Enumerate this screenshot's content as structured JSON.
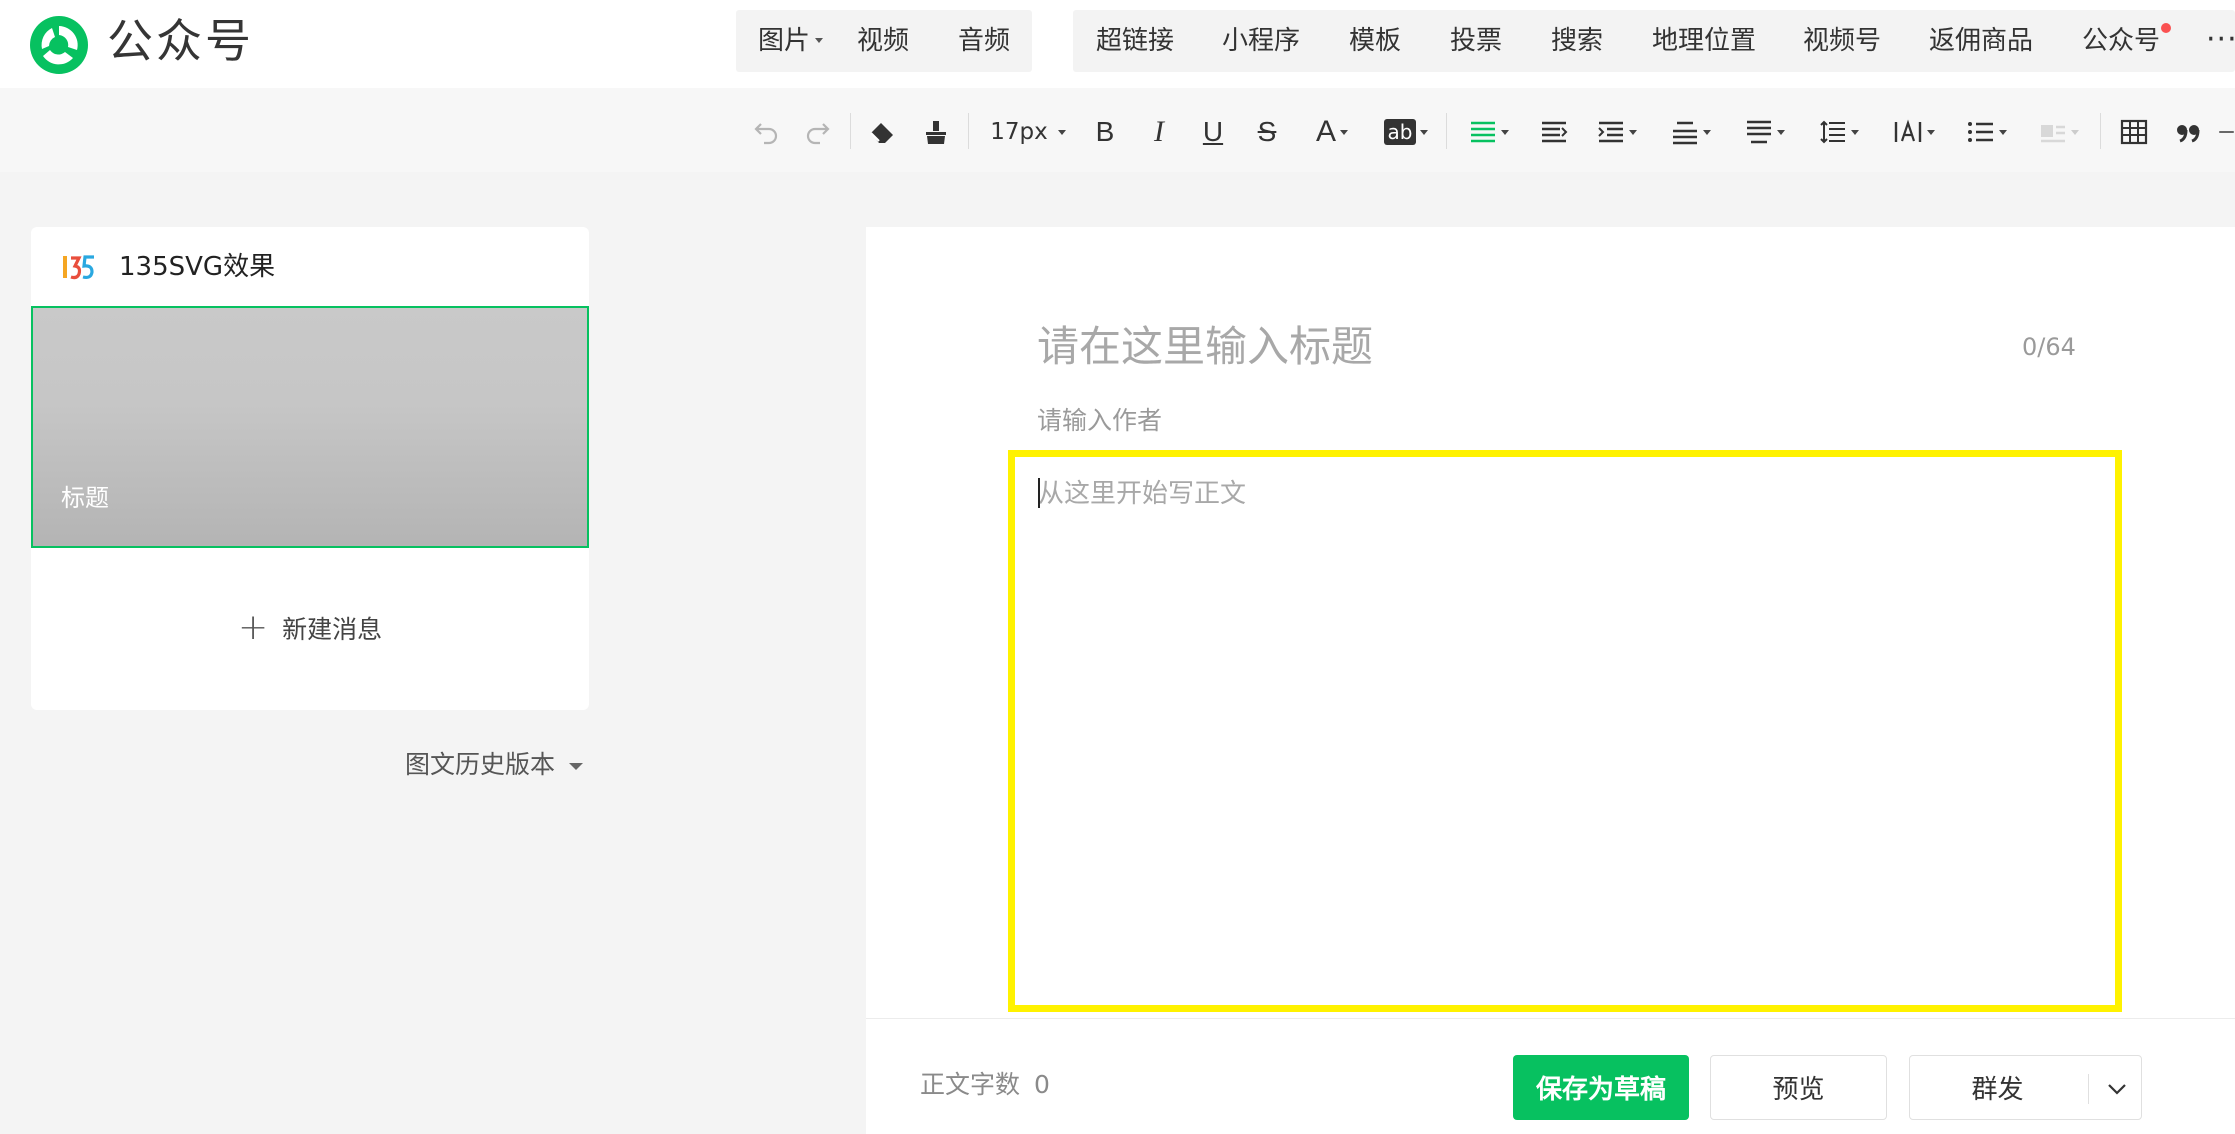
{
  "brand": {
    "name": "公众号"
  },
  "top_tabs": {
    "group1": [
      {
        "label": "图片",
        "has_caret": true
      },
      {
        "label": "视频"
      },
      {
        "label": "音频"
      }
    ],
    "group2": [
      {
        "label": "超链接"
      },
      {
        "label": "小程序"
      },
      {
        "label": "模板"
      },
      {
        "label": "投票"
      },
      {
        "label": "搜索"
      },
      {
        "label": "地理位置"
      },
      {
        "label": "视频号"
      },
      {
        "label": "返佣商品"
      },
      {
        "label": "公众号",
        "has_badge": true
      }
    ],
    "more": "···"
  },
  "toolbar": {
    "font_size": "17px",
    "bold": "B",
    "italic": "I",
    "underline": "U",
    "strike": "S",
    "font_color": "A",
    "bg_color": "ab"
  },
  "sidebar": {
    "account_name": "135SVG效果",
    "cover_title": "标题",
    "new_message": "新建消息",
    "history": "图文历史版本"
  },
  "editor": {
    "title_placeholder": "请在这里输入标题",
    "title_counter": "0/64",
    "author_placeholder": "请输入作者",
    "body_placeholder": "从这里开始写正文"
  },
  "footer": {
    "word_count_label": "正文字数",
    "word_count": "0",
    "save_draft": "保存为草稿",
    "preview": "预览",
    "publish": "群发"
  },
  "colors": {
    "accent": "#07c160",
    "highlight_border": "#fff200",
    "badge": "#fa5151"
  }
}
